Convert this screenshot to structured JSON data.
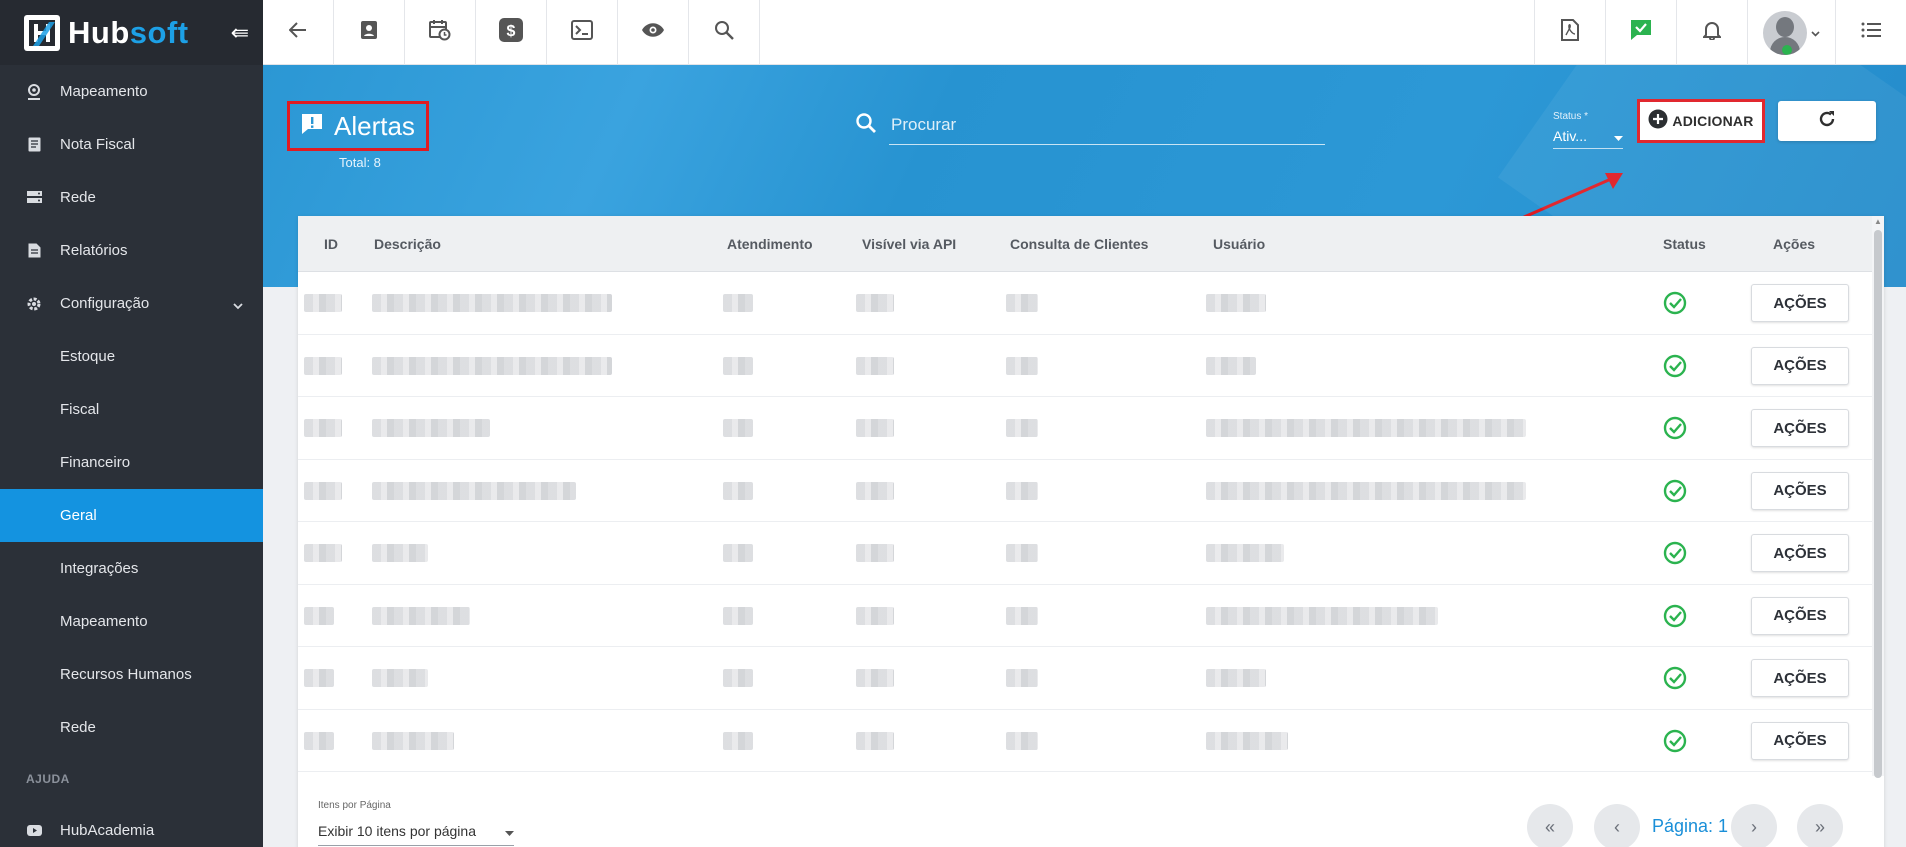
{
  "brand": {
    "hub": "Hub",
    "soft": "soft"
  },
  "sidebar": {
    "items": [
      {
        "label": "Mapeamento",
        "icon": "map-pin-icon"
      },
      {
        "label": "Nota Fiscal",
        "icon": "document-icon"
      },
      {
        "label": "Rede",
        "icon": "server-icon"
      },
      {
        "label": "Relatórios",
        "icon": "report-icon"
      },
      {
        "label": "Configuração",
        "icon": "gear-icon"
      }
    ],
    "subitems": [
      {
        "label": "Estoque"
      },
      {
        "label": "Fiscal"
      },
      {
        "label": "Financeiro"
      },
      {
        "label": "Geral",
        "active": true
      },
      {
        "label": "Integrações"
      },
      {
        "label": "Mapeamento"
      },
      {
        "label": "Recursos Humanos"
      },
      {
        "label": "Rede"
      }
    ],
    "section_help": "AJUDA",
    "help_items": [
      {
        "label": "HubAcademia",
        "icon": "youtube-icon"
      }
    ]
  },
  "topbar": {
    "left_icons": [
      "back-arrow-icon",
      "contact-icon",
      "calendar-clock-icon",
      "dollar-icon",
      "terminal-icon",
      "eye-icon",
      "search-icon"
    ],
    "right_icons": [
      "pdf-icon",
      "message-check-icon",
      "bell-icon"
    ]
  },
  "header": {
    "title": "Alertas",
    "total": "Total: 8",
    "search_placeholder": "Procurar",
    "status_label": "Status *",
    "status_value": "Ativ...",
    "add_label": "ADICIONAR"
  },
  "table": {
    "columns": [
      "ID",
      "Descrição",
      "Atendimento",
      "Visível via API",
      "Consulta de Clientes",
      "Usuário",
      "Status",
      "Ações"
    ],
    "row_action_label": "AÇÕES",
    "rows": [
      {
        "status": "ok"
      },
      {
        "status": "ok"
      },
      {
        "status": "ok"
      },
      {
        "status": "ok"
      },
      {
        "status": "ok"
      },
      {
        "status": "ok"
      },
      {
        "status": "ok"
      },
      {
        "status": "ok"
      }
    ]
  },
  "footer": {
    "items_per_page_label": "Itens por Página",
    "items_per_page_value": "Exibir 10 itens por página",
    "page_label": "Página: 1"
  },
  "colors": {
    "accent": "#1493e0",
    "sidebar": "#2b3038",
    "annotation": "#e01b22",
    "success": "#2bb34f"
  }
}
